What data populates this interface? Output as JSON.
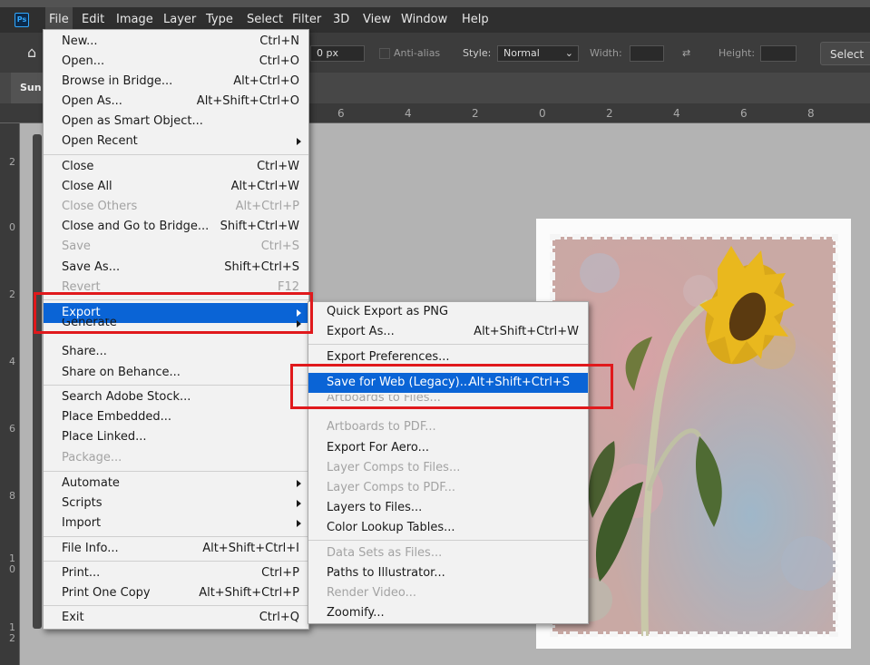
{
  "app": {
    "logo_text": "Ps",
    "menubar": [
      "File",
      "Edit",
      "Image",
      "Layer",
      "Type",
      "Select",
      "Filter",
      "3D",
      "View",
      "Window",
      "Help"
    ]
  },
  "options": {
    "feather_value": "0 px",
    "antialias_label": "Anti-alias",
    "style_label": "Style:",
    "style_value": "Normal",
    "width_label": "Width:",
    "height_label": "Height:",
    "select_button": "Select a"
  },
  "document": {
    "tab_label": "Sun"
  },
  "ruler": {
    "h_ticks": [
      "6",
      "4",
      "2",
      "0",
      "2",
      "4",
      "6",
      "8"
    ],
    "v_ticks": [
      "2",
      "0",
      "2",
      "4",
      "6",
      "8",
      "1\n0",
      "1\n2"
    ]
  },
  "file_menu": {
    "items": [
      {
        "label": "New...",
        "shortcut": "Ctrl+N"
      },
      {
        "label": "Open...",
        "shortcut": "Ctrl+O"
      },
      {
        "label": "Browse in Bridge...",
        "shortcut": "Alt+Ctrl+O"
      },
      {
        "label": "Open As...",
        "shortcut": "Alt+Shift+Ctrl+O"
      },
      {
        "label": "Open as Smart Object...",
        "shortcut": ""
      },
      {
        "label": "Open Recent",
        "shortcut": ""
      },
      {
        "label": "Close",
        "shortcut": "Ctrl+W"
      },
      {
        "label": "Close All",
        "shortcut": "Alt+Ctrl+W"
      },
      {
        "label": "Close Others",
        "shortcut": "Alt+Ctrl+P"
      },
      {
        "label": "Close and Go to Bridge...",
        "shortcut": "Shift+Ctrl+W"
      },
      {
        "label": "Save",
        "shortcut": "Ctrl+S"
      },
      {
        "label": "Save As...",
        "shortcut": "Shift+Ctrl+S"
      },
      {
        "label": "Revert",
        "shortcut": "F12"
      },
      {
        "label": "Export",
        "shortcut": ""
      },
      {
        "label": "Generate",
        "shortcut": ""
      },
      {
        "label": "Share...",
        "shortcut": ""
      },
      {
        "label": "Share on Behance...",
        "shortcut": ""
      },
      {
        "label": "Search Adobe Stock...",
        "shortcut": ""
      },
      {
        "label": "Place Embedded...",
        "shortcut": ""
      },
      {
        "label": "Place Linked...",
        "shortcut": ""
      },
      {
        "label": "Package...",
        "shortcut": ""
      },
      {
        "label": "Automate",
        "shortcut": ""
      },
      {
        "label": "Scripts",
        "shortcut": ""
      },
      {
        "label": "Import",
        "shortcut": ""
      },
      {
        "label": "File Info...",
        "shortcut": "Alt+Shift+Ctrl+I"
      },
      {
        "label": "Print...",
        "shortcut": "Ctrl+P"
      },
      {
        "label": "Print One Copy",
        "shortcut": "Alt+Shift+Ctrl+P"
      },
      {
        "label": "Exit",
        "shortcut": "Ctrl+Q"
      }
    ]
  },
  "export_menu": {
    "items": [
      {
        "label": "Quick Export as PNG",
        "shortcut": ""
      },
      {
        "label": "Export As...",
        "shortcut": "Alt+Shift+Ctrl+W"
      },
      {
        "label": "Export Preferences...",
        "shortcut": ""
      },
      {
        "label": "Save for Web (Legacy)...",
        "shortcut": "Alt+Shift+Ctrl+S"
      },
      {
        "label": "Artboards to Files...",
        "shortcut": ""
      },
      {
        "label": "Artboards to PDF...",
        "shortcut": ""
      },
      {
        "label": "Export For Aero...",
        "shortcut": ""
      },
      {
        "label": "Layer Comps to Files...",
        "shortcut": ""
      },
      {
        "label": "Layer Comps to PDF...",
        "shortcut": ""
      },
      {
        "label": "Layers to Files...",
        "shortcut": ""
      },
      {
        "label": "Color Lookup Tables...",
        "shortcut": ""
      },
      {
        "label": "Data Sets as Files...",
        "shortcut": ""
      },
      {
        "label": "Paths to Illustrator...",
        "shortcut": ""
      },
      {
        "label": "Render Video...",
        "shortcut": ""
      },
      {
        "label": "Zoomify...",
        "shortcut": ""
      }
    ]
  },
  "colors": {
    "highlight": "#0a64d6",
    "annotation_red": "#e0191c",
    "menu_bg": "#f2f2f2"
  }
}
